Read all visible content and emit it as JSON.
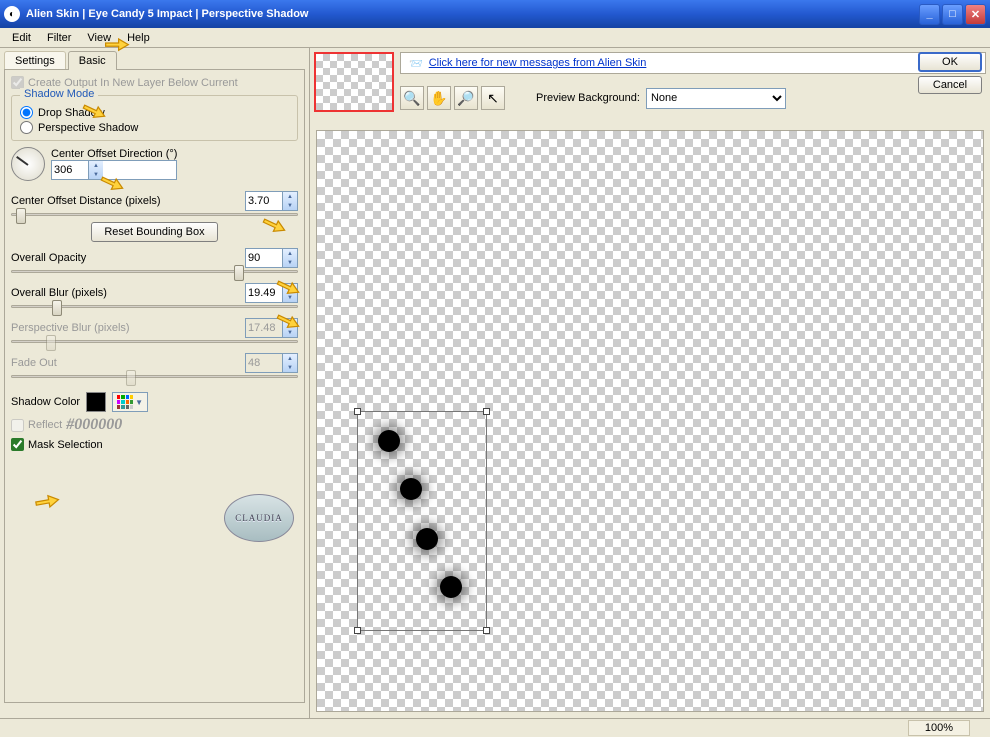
{
  "title": "Alien Skin  |  Eye Candy 5 Impact  |  Perspective Shadow",
  "menu": {
    "edit": "Edit",
    "filter": "Filter",
    "view": "View",
    "help": "Help"
  },
  "tabs": {
    "settings": "Settings",
    "basic": "Basic"
  },
  "createOutput": "Create Output In New Layer Below Current",
  "shadowMode": {
    "legend": "Shadow Mode",
    "drop": "Drop Shadow",
    "perspective": "Perspective Shadow"
  },
  "direction": {
    "label": "Center Offset Direction (°)",
    "value": "306"
  },
  "distance": {
    "label": "Center Offset Distance (pixels)",
    "value": "3.70"
  },
  "resetBtn": "Reset Bounding Box",
  "opacity": {
    "label": "Overall Opacity",
    "value": "90"
  },
  "blur": {
    "label": "Overall Blur (pixels)",
    "value": "19.49"
  },
  "pblur": {
    "label": "Perspective Blur (pixels)",
    "value": "17.48"
  },
  "fade": {
    "label": "Fade Out",
    "value": "48"
  },
  "shadowColor": "Shadow Color",
  "reflect": "Reflect",
  "hex": "#000000",
  "mask": "Mask Selection",
  "linkText": "Click here for new messages from Alien Skin",
  "ok": "OK",
  "cancel": "Cancel",
  "previewBg": {
    "label": "Preview Background:",
    "value": "None"
  },
  "zoom": "100%",
  "badge": "CLAUDIA"
}
